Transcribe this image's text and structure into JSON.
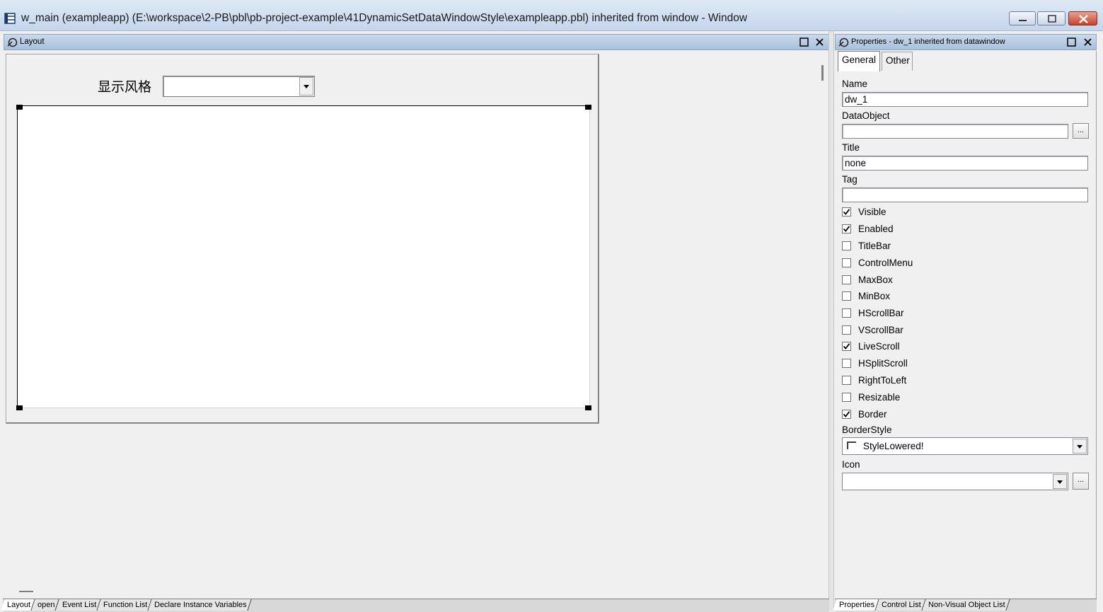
{
  "window": {
    "title": "w_main (exampleapp) (E:\\workspace\\2-PB\\pbl\\pb-project-example\\41DynamicSetDataWindowStyle\\exampleapp.pbl) inherited from window - Window"
  },
  "layout_pane": {
    "title": "Layout",
    "style_label": "显示风格",
    "style_combo_value": ""
  },
  "bottom_tabs": [
    "Layout",
    "open",
    "Event List",
    "Function List",
    "Declare Instance Variables"
  ],
  "properties_pane": {
    "title": "Properties - dw_1 inherited from datawindow",
    "tabs": [
      "General",
      "Other"
    ],
    "fields": {
      "name_label": "Name",
      "name_value": "dw_1",
      "dataobject_label": "DataObject",
      "dataobject_value": "",
      "title_label": "Title",
      "title_value": "none",
      "tag_label": "Tag",
      "tag_value": "",
      "ellipsis": "..."
    },
    "checkboxes": [
      {
        "label": "Visible",
        "checked": true
      },
      {
        "label": "Enabled",
        "checked": true
      },
      {
        "label": "TitleBar",
        "checked": false
      },
      {
        "label": "ControlMenu",
        "checked": false
      },
      {
        "label": "MaxBox",
        "checked": false
      },
      {
        "label": "MinBox",
        "checked": false
      },
      {
        "label": "HScrollBar",
        "checked": false
      },
      {
        "label": "VScrollBar",
        "checked": false
      },
      {
        "label": "LiveScroll",
        "checked": true
      },
      {
        "label": "HSplitScroll",
        "checked": false
      },
      {
        "label": "RightToLeft",
        "checked": false
      },
      {
        "label": "Resizable",
        "checked": false
      },
      {
        "label": "Border",
        "checked": true
      }
    ],
    "borderstyle_label": "BorderStyle",
    "borderstyle_value": "StyleLowered!",
    "icon_label": "Icon",
    "icon_value": ""
  },
  "props_bottom_tabs": [
    "Properties",
    "Control List",
    "Non-Visual Object List"
  ]
}
